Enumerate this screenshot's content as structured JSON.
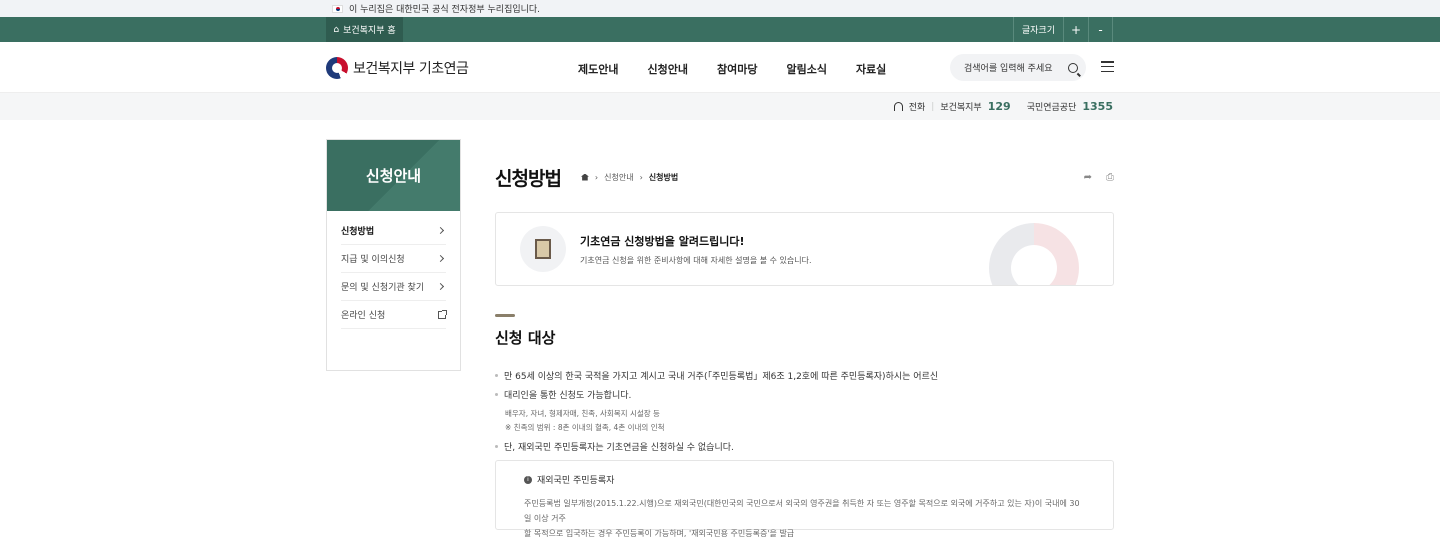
{
  "gov_banner": {
    "text": "이 누리집은 대한민국 공식 전자정부 누리집입니다."
  },
  "topbar": {
    "home_label": "보건복지부 홈",
    "font_size_label": "글자크기",
    "plus": "+",
    "minus": "-"
  },
  "header": {
    "logo": "보건복지부 기초연금",
    "nav": [
      "제도안내",
      "신청안내",
      "참여마당",
      "알림소식",
      "자료실"
    ],
    "search_label": "검색어를 입력해 주세요"
  },
  "contact": {
    "phone_label": "전화",
    "org1": "보건복지부",
    "num1": "129",
    "org2": "국민연금공단",
    "num2": "1355"
  },
  "lnb": {
    "title": "신청안내",
    "items": [
      {
        "label": "신청방법"
      },
      {
        "label": "지급 및 이의신청"
      },
      {
        "label": "문의 및 신청기관 찾기"
      },
      {
        "label": "온라인 신청"
      }
    ]
  },
  "page": {
    "title": "신청방법",
    "breadcrumb": [
      "신청안내",
      "신청방법"
    ],
    "notice_title": "기초연금 신청방법을 알려드립니다!",
    "notice_sub": "기초연금 신청을 위한 준비사항에 대해 자세한 설명을 볼 수 있습니다.",
    "section_title": "신청 대상",
    "bullet1": "만 65세 이상의 한국 국적을 가지고 계시고 국내 거주(「주민등록법」제6조 1,2호에 따른 주민등록자)하시는 어르신",
    "bullet2": "대리인을 통한 신청도 가능합니다.",
    "sub1": "배우자, 자녀, 형제자매, 친족, 사회복지 시설장 등",
    "sub2": "※ 친족의 범위 : 8촌 이내의 혈족, 4촌 이내의 인척",
    "bullet3": "단, 재외국민 주민등록자는 기초연금을 신청하실 수 없습니다.",
    "box_head": "재외국민 주민등록자",
    "box_body1": "주민등록법 일부개정(2015.1.22.시행)으로 재외국민(대한민국의 국민으로서 외국의 영주권을 취득한 자 또는 영주할 목적으로 외국에 거주하고 있는 자)이 국내에 30일 이상 거주",
    "box_body2": "할 목적으로 입국하는 경우 주민등록이 가능하며, '재외국민용 주민등록증'을 발급"
  }
}
